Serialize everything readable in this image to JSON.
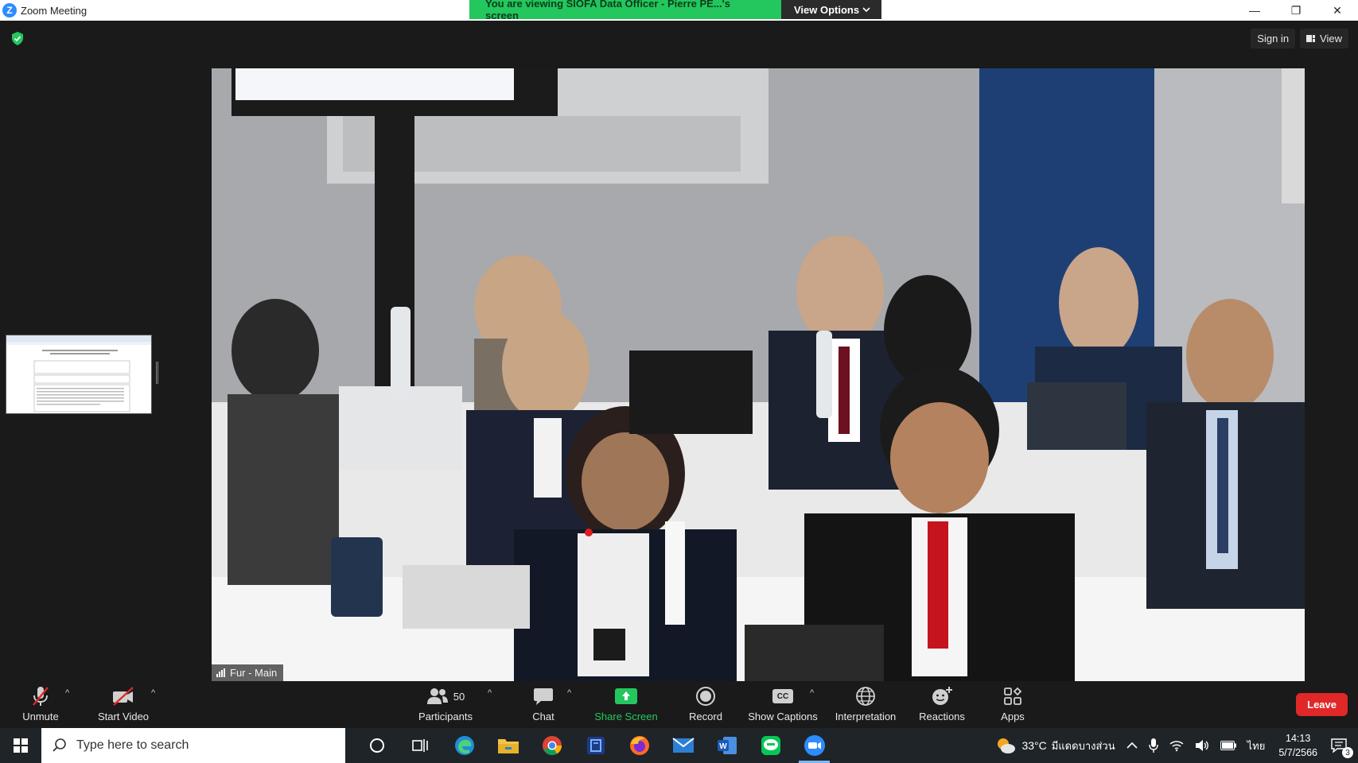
{
  "window": {
    "title": "Zoom Meeting",
    "logo_letter": "Z",
    "minimize_glyph": "—",
    "restore_glyph": "❐",
    "close_glyph": "✕"
  },
  "banner": {
    "viewing_text": "You are viewing SIOFA Data Officer - Pierre PE...'s screen",
    "view_options_label": "View Options"
  },
  "top_bar": {
    "sign_in_label": "Sign in",
    "view_label": "View"
  },
  "main_video": {
    "name_tag": "Fur - Main"
  },
  "toolbar": {
    "unmute_label": "Unmute",
    "start_video_label": "Start Video",
    "participants_label": "Participants",
    "participants_count": "50",
    "chat_label": "Chat",
    "share_screen_label": "Share Screen",
    "record_label": "Record",
    "show_captions_label": "Show Captions",
    "cc_glyph": "CC",
    "interpretation_label": "Interpretation",
    "reactions_label": "Reactions",
    "apps_label": "Apps",
    "leave_label": "Leave",
    "caret_glyph": "^"
  },
  "taskbar": {
    "search_placeholder": "Type here to search",
    "weather_temp": "33°C",
    "weather_text": "มีแดดบางส่วน",
    "language": "ไทย",
    "time": "14:13",
    "date": "5/7/2566",
    "notification_count": "3",
    "active_app": "zoom-icon"
  },
  "colors": {
    "banner_green": "#23c75d",
    "leave_red": "#e02828",
    "share_green": "#23c75d",
    "zoom_blue": "#2d8cff",
    "taskbar_bg": "#1f2428"
  }
}
